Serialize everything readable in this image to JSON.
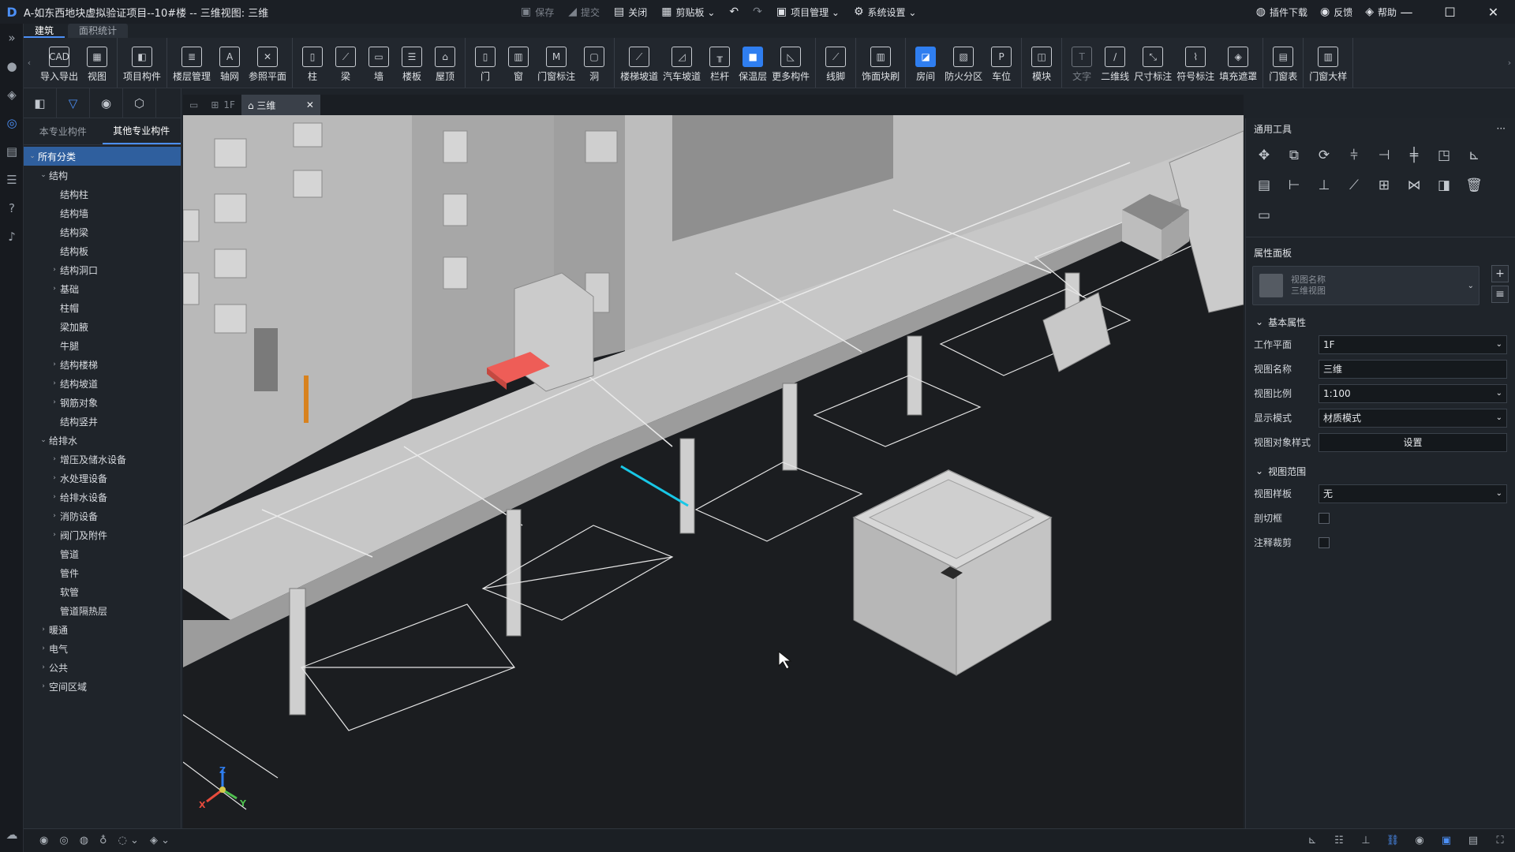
{
  "window": {
    "title": "A-如东西地块虚拟验证项目--10#楼 -- 三维视图: 三维",
    "logo": "D"
  },
  "titlebar": {
    "center": [
      {
        "label": "保存",
        "icon": "save-icon",
        "glyph": "▣",
        "dim": true
      },
      {
        "label": "提交",
        "icon": "submit-icon",
        "glyph": "◢",
        "dim": true
      },
      {
        "label": "关闭",
        "icon": "close-doc-icon",
        "glyph": "▤",
        "dim": false
      },
      {
        "label": "剪贴板 ⌄",
        "icon": "clipboard-icon",
        "glyph": "▦",
        "dim": false
      },
      {
        "label": "",
        "icon": "undo-icon",
        "glyph": "↶",
        "dim": false
      },
      {
        "label": "",
        "icon": "redo-icon",
        "glyph": "↷",
        "dim": true
      },
      {
        "label": "项目管理 ⌄",
        "icon": "project-icon",
        "glyph": "▣",
        "dim": false
      },
      {
        "label": "系统设置 ⌄",
        "icon": "gear-icon",
        "glyph": "⚙",
        "dim": false
      }
    ],
    "right": [
      {
        "label": "插件下载",
        "icon": "plugin-icon",
        "glyph": "◍"
      },
      {
        "label": "反馈",
        "icon": "feedback-icon",
        "glyph": "◉"
      },
      {
        "label": "帮助",
        "icon": "help-icon",
        "glyph": "◈"
      }
    ],
    "controls": {
      "minimize": "—",
      "maximize": "☐",
      "close": "✕"
    }
  },
  "ribbon_tabs": [
    "建筑",
    "面积统计"
  ],
  "ribbon": {
    "groups": [
      [
        {
          "label": "导入导出",
          "glyph": "CAD"
        },
        {
          "label": "视图",
          "glyph": "▦"
        }
      ],
      [
        {
          "label": "项目构件",
          "glyph": "◧"
        }
      ],
      [
        {
          "label": "楼层管理",
          "glyph": "≣"
        },
        {
          "label": "轴网",
          "glyph": "A"
        },
        {
          "label": "参照平面",
          "glyph": "✕"
        }
      ],
      [
        {
          "label": "柱",
          "glyph": "▯"
        },
        {
          "label": "梁",
          "glyph": "⟋"
        },
        {
          "label": "墙",
          "glyph": "▭"
        },
        {
          "label": "楼板",
          "glyph": "☰"
        },
        {
          "label": "屋顶",
          "glyph": "⌂"
        }
      ],
      [
        {
          "label": "门",
          "glyph": "▯"
        },
        {
          "label": "窗",
          "glyph": "▥"
        },
        {
          "label": "门窗标注",
          "glyph": "M"
        },
        {
          "label": "洞",
          "glyph": "▢"
        }
      ],
      [
        {
          "label": "楼梯坡道",
          "glyph": "⟋"
        },
        {
          "label": "汽车坡道",
          "glyph": "◿"
        },
        {
          "label": "栏杆",
          "glyph": "╥"
        },
        {
          "label": "保温层",
          "glyph": "■",
          "blue": true
        },
        {
          "label": "更多构件",
          "glyph": "◺"
        }
      ],
      [
        {
          "label": "线脚",
          "glyph": "⟋"
        }
      ],
      [
        {
          "label": "饰面块刷",
          "glyph": "▥"
        }
      ],
      [
        {
          "label": "房间",
          "glyph": "◪",
          "blue": true
        },
        {
          "label": "防火分区",
          "glyph": "▧"
        },
        {
          "label": "车位",
          "glyph": "P"
        }
      ],
      [
        {
          "label": "模块",
          "glyph": "◫"
        }
      ],
      [
        {
          "label": "文字",
          "glyph": "T",
          "dim": true
        },
        {
          "label": "二维线",
          "glyph": "∕"
        },
        {
          "label": "尺寸标注",
          "glyph": "⤡"
        },
        {
          "label": "符号标注",
          "glyph": "⌇"
        },
        {
          "label": "填充遮罩",
          "glyph": "◈"
        }
      ],
      [
        {
          "label": "门窗表",
          "glyph": "▤"
        }
      ],
      [
        {
          "label": "门窗大样",
          "glyph": "▥"
        }
      ]
    ]
  },
  "leftbar": [
    {
      "icon": "expand-icon",
      "glyph": "»"
    },
    {
      "icon": "avatar-icon",
      "glyph": "●"
    },
    {
      "icon": "cube-icon",
      "glyph": "◈"
    },
    {
      "icon": "component-icon",
      "glyph": "◎",
      "active": true
    },
    {
      "icon": "document-icon",
      "glyph": "▤"
    },
    {
      "icon": "layers-icon",
      "glyph": "☰"
    },
    {
      "icon": "help-circle-icon",
      "glyph": "?"
    },
    {
      "icon": "bell-icon",
      "glyph": "♪"
    }
  ],
  "leftbar_bottom": {
    "icon": "cloud-icon",
    "glyph": "☁"
  },
  "left_panel": {
    "tools": [
      {
        "icon": "panel-toggle-icon",
        "glyph": "◧"
      },
      {
        "icon": "filter-icon",
        "glyph": "▽",
        "active": true
      },
      {
        "icon": "location-icon",
        "glyph": "◉"
      },
      {
        "icon": "box-icon",
        "glyph": "⬡"
      }
    ],
    "tabs": [
      "本专业构件",
      "其他专业构件"
    ],
    "active_tab": 1,
    "tree": [
      {
        "label": "所有分类",
        "level": 0,
        "arrow": "⌄",
        "sel": true
      },
      {
        "label": "结构",
        "level": 1,
        "arrow": "⌄"
      },
      {
        "label": "结构柱",
        "level": 2,
        "arrow": ""
      },
      {
        "label": "结构墙",
        "level": 2,
        "arrow": ""
      },
      {
        "label": "结构梁",
        "level": 2,
        "arrow": ""
      },
      {
        "label": "结构板",
        "level": 2,
        "arrow": ""
      },
      {
        "label": "结构洞口",
        "level": 2,
        "arrow": "›"
      },
      {
        "label": "基础",
        "level": 2,
        "arrow": "›"
      },
      {
        "label": "柱帽",
        "level": 2,
        "arrow": ""
      },
      {
        "label": "梁加腋",
        "level": 2,
        "arrow": ""
      },
      {
        "label": "牛腿",
        "level": 2,
        "arrow": ""
      },
      {
        "label": "结构楼梯",
        "level": 2,
        "arrow": "›"
      },
      {
        "label": "结构坡道",
        "level": 2,
        "arrow": "›"
      },
      {
        "label": "钢筋对象",
        "level": 2,
        "arrow": "›"
      },
      {
        "label": "结构竖井",
        "level": 2,
        "arrow": ""
      },
      {
        "label": "给排水",
        "level": 1,
        "arrow": "⌄"
      },
      {
        "label": "增压及储水设备",
        "level": 2,
        "arrow": "›"
      },
      {
        "label": "水处理设备",
        "level": 2,
        "arrow": "›"
      },
      {
        "label": "给排水设备",
        "level": 2,
        "arrow": "›"
      },
      {
        "label": "消防设备",
        "level": 2,
        "arrow": "›"
      },
      {
        "label": "阀门及附件",
        "level": 2,
        "arrow": "›"
      },
      {
        "label": "管道",
        "level": 2,
        "arrow": ""
      },
      {
        "label": "管件",
        "level": 2,
        "arrow": ""
      },
      {
        "label": "软管",
        "level": 2,
        "arrow": ""
      },
      {
        "label": "管道隔热层",
        "level": 2,
        "arrow": ""
      },
      {
        "label": "暖通",
        "level": 1,
        "arrow": "›"
      },
      {
        "label": "电气",
        "level": 1,
        "arrow": "›"
      },
      {
        "label": "公共",
        "level": 1,
        "arrow": "›"
      },
      {
        "label": "空间区域",
        "level": 1,
        "arrow": "›"
      }
    ]
  },
  "view_tabs": [
    {
      "label": "",
      "icon": "view-list-icon",
      "glyph": "▭"
    },
    {
      "label": "1F",
      "icon": "floorplan-icon",
      "glyph": "⊞"
    },
    {
      "label": "三维",
      "icon": "3d-view-icon",
      "glyph": "⌂",
      "active": true,
      "close": "✕"
    }
  ],
  "right_panel": {
    "tools_title": "通用工具",
    "tools_more": "···",
    "tools": [
      {
        "icon": "move-icon",
        "glyph": "✥"
      },
      {
        "icon": "copy-icon",
        "glyph": "⧉"
      },
      {
        "icon": "rotate-icon",
        "glyph": "⟳"
      },
      {
        "icon": "align-icon",
        "glyph": "⫩"
      },
      {
        "icon": "split-icon",
        "glyph": "⊣"
      },
      {
        "icon": "extend-icon",
        "glyph": "╪"
      },
      {
        "icon": "offset-icon",
        "glyph": "◳"
      },
      {
        "icon": "array-icon",
        "glyph": "⊾"
      },
      {
        "icon": "stack-icon",
        "glyph": "▤"
      },
      {
        "icon": "trim-icon",
        "glyph": "⊢"
      },
      {
        "icon": "break-icon",
        "glyph": "⊥"
      },
      {
        "icon": "scale-icon",
        "glyph": "⟋"
      },
      {
        "icon": "group-icon",
        "glyph": "⊞"
      },
      {
        "icon": "mirror-icon",
        "glyph": "⋈"
      },
      {
        "icon": "pin-icon",
        "glyph": "◨"
      },
      {
        "icon": "delete-icon",
        "glyph": "🗑"
      },
      {
        "icon": "measure-icon",
        "glyph": "▭"
      }
    ],
    "props_title": "属性面板",
    "card": {
      "line1": "视图名称",
      "line2": "三维视图"
    },
    "card_buttons": [
      {
        "icon": "add-icon",
        "glyph": "+"
      },
      {
        "icon": "list-icon",
        "glyph": "≡"
      }
    ],
    "sections": [
      {
        "title": "基本属性",
        "rows": [
          {
            "label": "工作平面",
            "value": "1F",
            "type": "select"
          },
          {
            "label": "视图名称",
            "value": "三维",
            "type": "text"
          },
          {
            "label": "视图比例",
            "value": "1:100",
            "type": "select"
          },
          {
            "label": "显示模式",
            "value": "材质模式",
            "type": "select"
          },
          {
            "label": "视图对象样式",
            "value": "设置",
            "type": "button"
          }
        ]
      },
      {
        "title": "视图范围",
        "rows": [
          {
            "label": "视图样板",
            "value": "无",
            "type": "select"
          },
          {
            "label": "剖切框",
            "value": "",
            "type": "checkbox"
          },
          {
            "label": "注释裁剪",
            "value": "",
            "type": "checkbox"
          }
        ]
      }
    ]
  },
  "statusbar": {
    "left": [
      {
        "icon": "eye-icon",
        "glyph": "◉"
      },
      {
        "icon": "isolate-icon",
        "glyph": "◎"
      },
      {
        "icon": "hide-icon",
        "glyph": "◍"
      },
      {
        "icon": "light-icon",
        "glyph": "♁"
      },
      {
        "icon": "visibility-icon",
        "glyph": "◌ ⌄"
      },
      {
        "icon": "render-icon",
        "glyph": "◈ ⌄"
      }
    ],
    "right": [
      {
        "icon": "axis-icon",
        "glyph": "⊾"
      },
      {
        "icon": "layer-list-icon",
        "glyph": "☷"
      },
      {
        "icon": "section-icon",
        "glyph": "⊥"
      },
      {
        "icon": "link-icon",
        "glyph": "⛓"
      },
      {
        "icon": "snap-icon",
        "glyph": "◉"
      },
      {
        "icon": "window-icon",
        "glyph": "▣"
      },
      {
        "icon": "grid-icon",
        "glyph": "▤"
      },
      {
        "icon": "fullscreen-icon",
        "glyph": "⛶"
      }
    ]
  },
  "axes": {
    "x": "X",
    "y": "Y",
    "z": "Z"
  }
}
